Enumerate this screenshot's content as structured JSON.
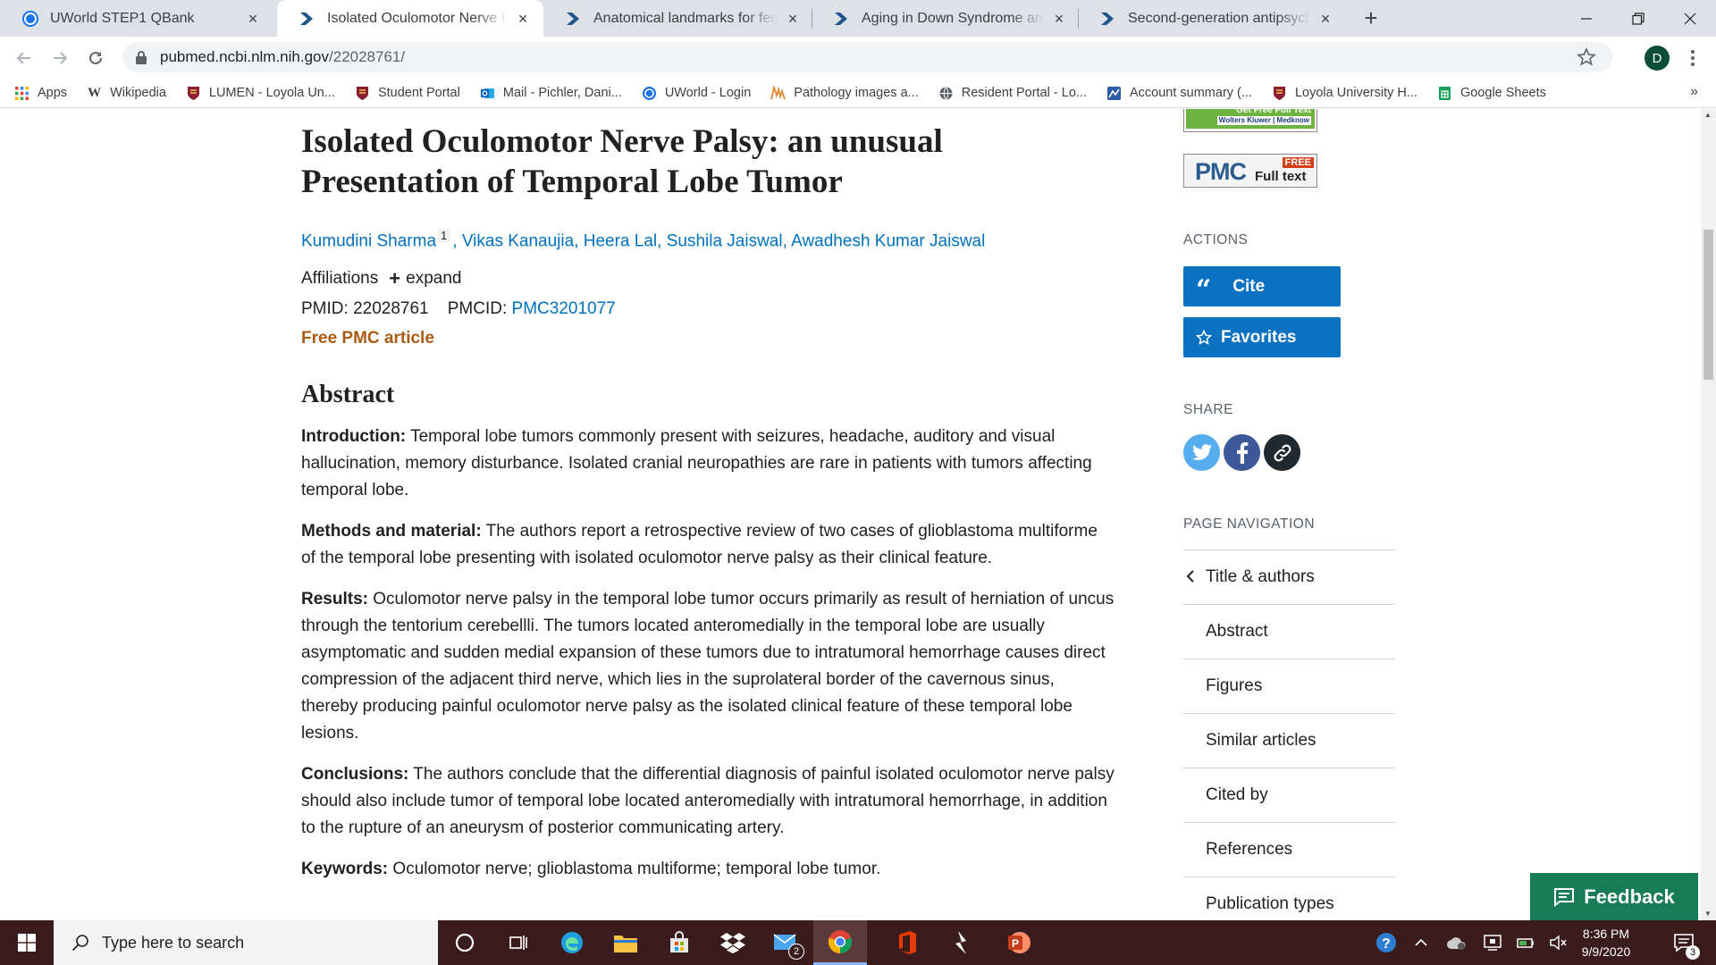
{
  "tabs": [
    {
      "title": "UWorld STEP1 QBank",
      "icon": "uworld-icon",
      "active": false
    },
    {
      "title": "Isolated Oculomotor Nerve Palsy: an unusual Presentation of Temporal Lobe Tumor",
      "icon": "pubmed-icon",
      "active": true
    },
    {
      "title": "Anatomical landmarks for femoral",
      "icon": "pubmed-icon",
      "active": false
    },
    {
      "title": "Aging in Down Syndrome and the",
      "icon": "pubmed-icon",
      "active": false
    },
    {
      "title": "Second-generation antipsychotic",
      "icon": "pubmed-icon",
      "active": false
    }
  ],
  "toolbar": {
    "url_host": "pubmed.ncbi.nlm.nih.gov",
    "url_path": "/22028761/",
    "profile_initial": "D"
  },
  "bookmarks": [
    {
      "label": "Apps",
      "icon": "apps-grid-icon"
    },
    {
      "label": "Wikipedia",
      "icon": "wikipedia-icon"
    },
    {
      "label": "LUMEN - Loyola Un...",
      "icon": "loyola-shield-icon"
    },
    {
      "label": "Student Portal",
      "icon": "loyola-shield-icon"
    },
    {
      "label": "Mail - Pichler, Dani...",
      "icon": "outlook-icon"
    },
    {
      "label": "UWorld - Login",
      "icon": "uworld-icon"
    },
    {
      "label": "Pathology images a...",
      "icon": "pathology-icon"
    },
    {
      "label": "Resident Portal - Lo...",
      "icon": "globe-icon"
    },
    {
      "label": "Account summary (...",
      "icon": "account-icon"
    },
    {
      "label": "Loyola University H...",
      "icon": "loyola-shield-icon"
    },
    {
      "label": "Google Sheets",
      "icon": "google-sheets-icon"
    }
  ],
  "article": {
    "title": "Isolated Oculomotor Nerve Palsy: an unusual Presentation of Temporal Lobe Tumor",
    "authors": [
      "Kumudini Sharma",
      "Vikas Kanaujia",
      "Heera Lal",
      "Sushila Jaiswal",
      "Awadhesh Kumar Jaiswal"
    ],
    "first_author_sup": "1",
    "affiliations_label": "Affiliations",
    "expand_label": "expand",
    "pmid_label": "PMID:",
    "pmid": "22028761",
    "pmcid_label": "PMCID:",
    "pmcid": "PMC3201077",
    "free_label": "Free PMC article",
    "abstract_heading": "Abstract",
    "abstract": [
      {
        "label": "Introduction:",
        "text": "Temporal lobe tumors commonly present with seizures, headache, auditory and visual hallucination, memory disturbance. Isolated cranial neuropathies are rare in patients with tumors affecting temporal lobe."
      },
      {
        "label": "Methods and material:",
        "text": "The authors report a retrospective review of two cases of glioblastoma multiforme of the temporal lobe presenting with isolated oculomotor nerve palsy as their clinical feature."
      },
      {
        "label": "Results:",
        "text": "Oculomotor nerve palsy in the temporal lobe tumor occurs primarily as result of herniation of uncus through the tentorium cerebellli. The tumors located anteromedially in the temporal lobe are usually asymptomatic and sudden medial expansion of these tumors due to intratumoral hemorrhage causes direct compression of the adjacent third nerve, which lies in the suprolateral border of the cavernous sinus, thereby producing painful oculomotor nerve palsy as the isolated clinical feature of these temporal lobe lesions."
      },
      {
        "label": "Conclusions:",
        "text": "The authors conclude that the differential diagnosis of painful isolated oculomotor nerve palsy should also include tumor of temporal lobe located anteromedially with intratumoral hemorrhage, in addition to the rupture of an aneurysm of posterior communicating artery."
      },
      {
        "label": "Keywords:",
        "text": "Oculomotor nerve; glioblastoma multiforme; temporal lobe tumor."
      }
    ]
  },
  "sidebar": {
    "linkout_1": {
      "line1": "Get Free Full Text",
      "line2": "Wolters Kluwer | Medknow"
    },
    "linkout_2": {
      "brand": "PMC",
      "badge": "FREE",
      "text": "Full text"
    },
    "actions_label": "ACTIONS",
    "cite_label": "Cite",
    "favorites_label": "Favorites",
    "share_label": "SHARE",
    "page_nav_label": "PAGE NAVIGATION",
    "nav_items": [
      "Title & authors",
      "Abstract",
      "Figures",
      "Similar articles",
      "Cited by",
      "References",
      "Publication types"
    ]
  },
  "feedback_label": "Feedback",
  "taskbar": {
    "search_placeholder": "Type here to search",
    "time": "8:36 PM",
    "date": "9/9/2020",
    "mail_badge": "2",
    "notification_badge": "3"
  },
  "colors": {
    "link": "#0071bc",
    "free_pmc": "#aa5c14",
    "button": "#0b72c2",
    "feedback": "#187c59",
    "taskbar": "#3a1c1c"
  }
}
